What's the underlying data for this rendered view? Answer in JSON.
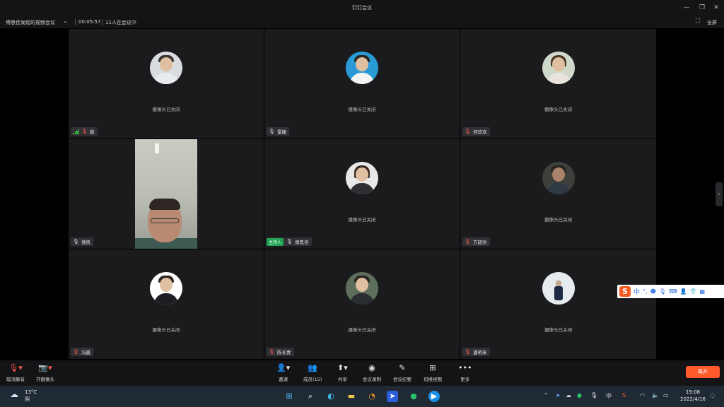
{
  "window": {
    "title": "钉钉会议",
    "minimize": "—",
    "restore": "❐",
    "close": "✕"
  },
  "infobar": {
    "meeting_title": "傅思佳发起的视频会议",
    "timer": "00:05:57",
    "participant_count": "11人在会议中",
    "fullscreen_label": "全屏"
  },
  "camera_off_text": "摄像头已关闭",
  "participants": [
    {
      "name": "我",
      "mic": "muted",
      "signal": true
    },
    {
      "name": "雷婕",
      "mic": "on"
    },
    {
      "name": "何欢欢",
      "mic": "muted"
    },
    {
      "name": "傅凯",
      "mic": "on",
      "video": true
    },
    {
      "name": "傅思佳",
      "mic": "on",
      "host": true,
      "host_label": "主持人"
    },
    {
      "name": "方韶剑",
      "mic": "muted"
    },
    {
      "name": "冯晨",
      "mic": "muted"
    },
    {
      "name": "陈长青",
      "mic": "muted"
    },
    {
      "name": "潘明来",
      "mic": "muted"
    }
  ],
  "toolbar": {
    "unmute": "取消静音",
    "start_camera": "开摄像头",
    "invite": "邀请",
    "members": "成员(15)",
    "share": "共享",
    "record": "会议录制",
    "minutes": "会议纪要",
    "switch_view": "切换视图",
    "more": "更多",
    "leave": "离开"
  },
  "ime": {
    "logo": "S",
    "mode": "中"
  },
  "taskbar": {
    "temperature": "13°C",
    "weather": "阴",
    "time": "19:08",
    "date": "2022/4/16",
    "input_lang": "中"
  },
  "colors": {
    "leave_button": "#ff5a2b",
    "host_badge": "#1fa352",
    "muted_mic": "#ff5a4e"
  }
}
